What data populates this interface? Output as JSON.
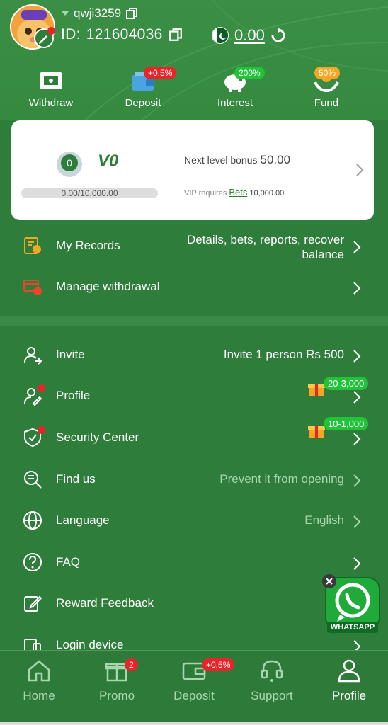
{
  "header": {
    "username": "qwji3259",
    "id_label": "ID:",
    "id_value": "121604036",
    "balance": "0.00"
  },
  "quick_actions": [
    {
      "label": "Withdraw",
      "icon": "withdraw-icon",
      "badge": ""
    },
    {
      "label": "Deposit",
      "icon": "wallet-icon",
      "badge": "+0.5%"
    },
    {
      "label": "Interest",
      "icon": "piggy-bank-icon",
      "badge": "200%"
    },
    {
      "label": "Fund",
      "icon": "fund-hands-icon",
      "badge": "50%"
    }
  ],
  "vip": {
    "medal_level": "0",
    "level_label": "V0",
    "progress_text": "0.00/10,000.00",
    "progress_fraction": 0,
    "next_level_label": "Next level bonus",
    "next_level_value": "50.00",
    "requires_label": "VIP requires",
    "bets_link": "Bets",
    "requires_amount": "10,000.00"
  },
  "records_menu": [
    {
      "label": "My Records",
      "icon": "records-icon",
      "detail_line1": "Details, bets, reports, recover",
      "detail_line2": "balance"
    },
    {
      "label": "Manage withdrawal",
      "icon": "withdrawal-card-icon",
      "detail": ""
    }
  ],
  "settings_menu": [
    {
      "label": "Invite",
      "icon": "invite-user-icon",
      "detail": "Invite 1 person Rs 500"
    },
    {
      "label": "Profile",
      "icon": "profile-edit-icon",
      "reward": "20-3,000"
    },
    {
      "label": "Security Center",
      "icon": "shield-check-icon",
      "reward": "10-1,000"
    },
    {
      "label": "Find us",
      "icon": "find-search-icon",
      "detail": "Prevent it from opening"
    },
    {
      "label": "Language",
      "icon": "globe-icon",
      "detail": "English"
    },
    {
      "label": "FAQ",
      "icon": "question-icon",
      "detail": ""
    },
    {
      "label": "Reward Feedback",
      "icon": "feedback-edit-icon",
      "detail": ""
    },
    {
      "label": "Login device",
      "icon": "device-icon",
      "detail": ""
    }
  ],
  "whatsapp": {
    "label": "WHATSAPP"
  },
  "tabbar": [
    {
      "label": "Home",
      "icon": "home-icon",
      "badge": "",
      "active": false
    },
    {
      "label": "Promo",
      "icon": "gift-icon",
      "badge": "2",
      "active": false
    },
    {
      "label": "Deposit",
      "icon": "wallet-icon",
      "badge": "+0.5%",
      "active": false
    },
    {
      "label": "Support",
      "icon": "headset-icon",
      "badge": "",
      "active": false
    },
    {
      "label": "Profile",
      "icon": "person-icon",
      "badge": "",
      "active": true
    }
  ],
  "colors": {
    "primary_green": "#2f7d3a",
    "accent_red": "#e8242b",
    "badge_green": "#22c33a",
    "badge_orange": "#f5a623"
  }
}
